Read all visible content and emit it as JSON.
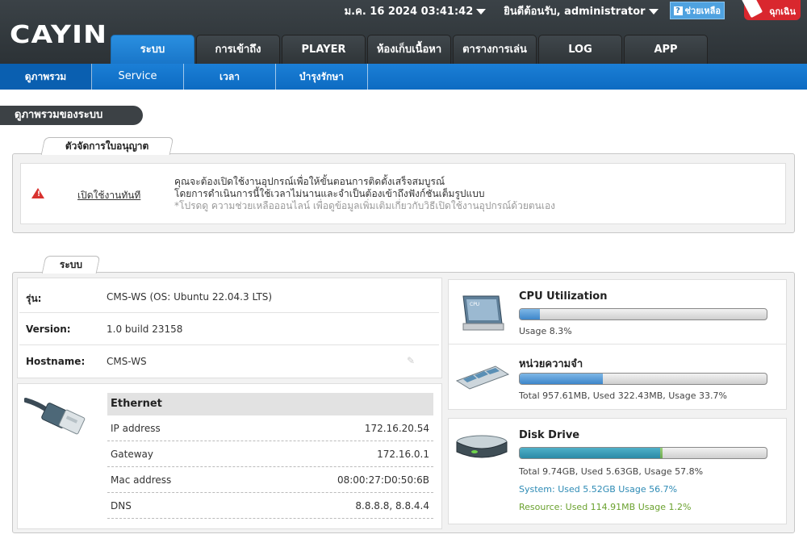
{
  "header": {
    "logo": "CAYIN",
    "datetime": "ม.ค. 16 2024 03:41:42",
    "welcome": "ยินดีต้อนรับ, administrator",
    "help": "ช่วยเหลือ",
    "emergency": "ฉุกเฉิน"
  },
  "tabs": [
    "ระบบ",
    "การเข้าถึง",
    "PLAYER",
    "ห้องเก็บเนื้อหา",
    "ตารางการเล่น",
    "LOG",
    "APP"
  ],
  "subnav": [
    "ดูภาพรวม",
    "Service",
    "เวลา",
    "บำรุงรักษา"
  ],
  "page_title": "ดูภาพรวมของระบบ",
  "license": {
    "section": "ตัวจัดการใบอนุญาต",
    "link": "เปิดใช้งานทันที",
    "line1": "คุณจะต้องเปิดใช้งานอุปกรณ์เพื่อให้ขั้นตอนการติดตั้งเสร็จสมบูรณ์",
    "line2": "โดยการดำเนินการนี้ใช้เวลาไม่นานและจำเป็นต้องเข้าถึงฟังก์ชันเต็มรูปแบบ",
    "note": "*โปรดดู ความช่วยเหลือออนไลน์ เพื่อดูข้อมูลเพิ่มเติมเกี่ยวกับวิธีเปิดใช้งานอุปกรณ์ด้วยตนเอง"
  },
  "system": {
    "section": "ระบบ",
    "rows": [
      {
        "label": "รุ่น:",
        "value": "CMS-WS (OS: Ubuntu 22.04.3 LTS)"
      },
      {
        "label": "Version:",
        "value": "1.0 build 23158"
      },
      {
        "label": "Hostname:",
        "value": "CMS-WS"
      }
    ],
    "ethernet": {
      "title": "Ethernet",
      "rows": [
        {
          "label": "IP address",
          "value": "172.16.20.54"
        },
        {
          "label": "Gateway",
          "value": "172.16.0.1"
        },
        {
          "label": "Mac address",
          "value": "08:00:27:D0:50:6B"
        },
        {
          "label": "DNS",
          "value": "8.8.8.8, 8.8.4.4"
        }
      ]
    }
  },
  "cpu": {
    "title": "CPU Utilization",
    "usage_text": "Usage 8.3%",
    "usage_pct": 8.3
  },
  "memory": {
    "title": "หน่วยความจำ",
    "usage_text": "Total 957.61MB, Used 322.43MB, Usage 33.7%",
    "usage_pct": 33.7
  },
  "disk": {
    "title": "Disk Drive",
    "usage_text": "Total 9.74GB, Used 5.63GB, Usage 57.8%",
    "system_text": "System: Used 5.52GB Usage 56.7%",
    "resource_text": "Resource: Used 114.91MB Usage 1.2%",
    "system_pct": 56.7,
    "resource_pct": 1.2
  },
  "colors": {
    "accent": "#1b7fd6",
    "header": "#32383c",
    "emergency": "#d9272e"
  }
}
